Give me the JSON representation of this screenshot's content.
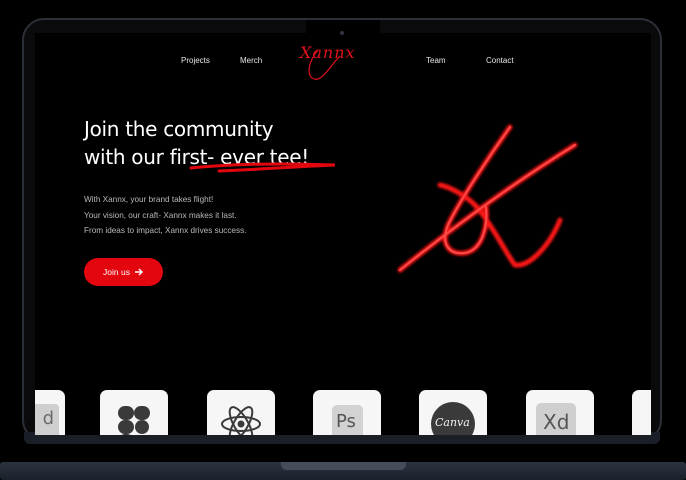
{
  "nav": {
    "items": [
      "Projects",
      "Merch",
      "Team",
      "Contact"
    ],
    "logo": "Xannx"
  },
  "hero": {
    "title_line1": "Join the community",
    "title_line2_prefix": "with our ",
    "title_highlight": "first- ever tee",
    "title_line2_suffix": "!",
    "lines": [
      "With Xannx, your brand takes flight!",
      "Your vision, our craft- Xannx makes it last.",
      "From ideas to impact, Xannx  drives success."
    ],
    "cta_label": "Join us",
    "cta_icon": "arrow-right-icon"
  },
  "tools": {
    "icons": [
      "adobe-id-icon",
      "figma-icon",
      "react-icon",
      "photoshop-icon",
      "canva-icon",
      "adobe-xd-icon",
      "partial-tile-icon"
    ],
    "ps_text": "Ps",
    "canva_text": "Canva",
    "xd_text": "Xd",
    "id_text": "d"
  },
  "colors": {
    "accent": "#e3060f",
    "background": "#000000",
    "text": "#ffffff",
    "muted_text": "#b9b9b9"
  }
}
